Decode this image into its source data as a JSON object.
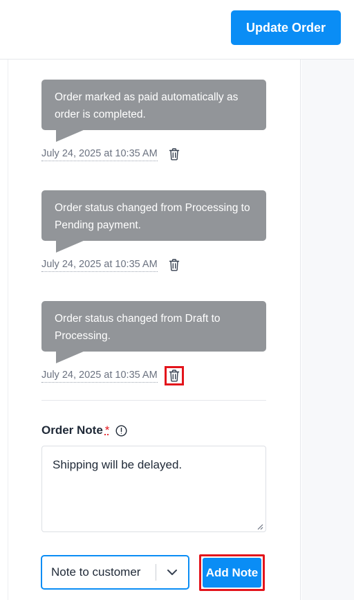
{
  "header": {
    "update_button": "Update Order"
  },
  "notes": [
    {
      "text": "Order marked as paid automatically as order is completed.",
      "date": "July 24, 2025 at 10:35 AM"
    },
    {
      "text": "Order status changed from Processing to Pending payment.",
      "date": "July 24, 2025 at 10:35 AM"
    },
    {
      "text": "Order status changed from Draft to Processing.",
      "date": "July 24, 2025 at 10:35 AM"
    }
  ],
  "add_note": {
    "label": "Order Note",
    "required_marker": "*",
    "textarea_value": "Shipping will be delayed.",
    "note_type_selected": "Note to customer",
    "submit_label": "Add Note"
  },
  "colors": {
    "primary": "#0a8df5",
    "bubble": "#929599",
    "highlight": "#e3141b"
  },
  "icons": {
    "delete": "trash-icon",
    "info": "info-icon",
    "dropdown": "chevron-down-icon"
  }
}
